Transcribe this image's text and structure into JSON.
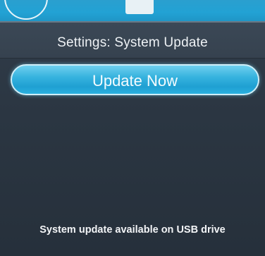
{
  "header": {
    "title": "Settings: System Update"
  },
  "main": {
    "update_button_label": "Update Now",
    "status_message": "System update available on USB drive"
  },
  "colors": {
    "accent": "#22a2d4",
    "background": "#2b3642"
  },
  "icons": {
    "top_left": "back-icon",
    "top_center": "home-indicator"
  }
}
